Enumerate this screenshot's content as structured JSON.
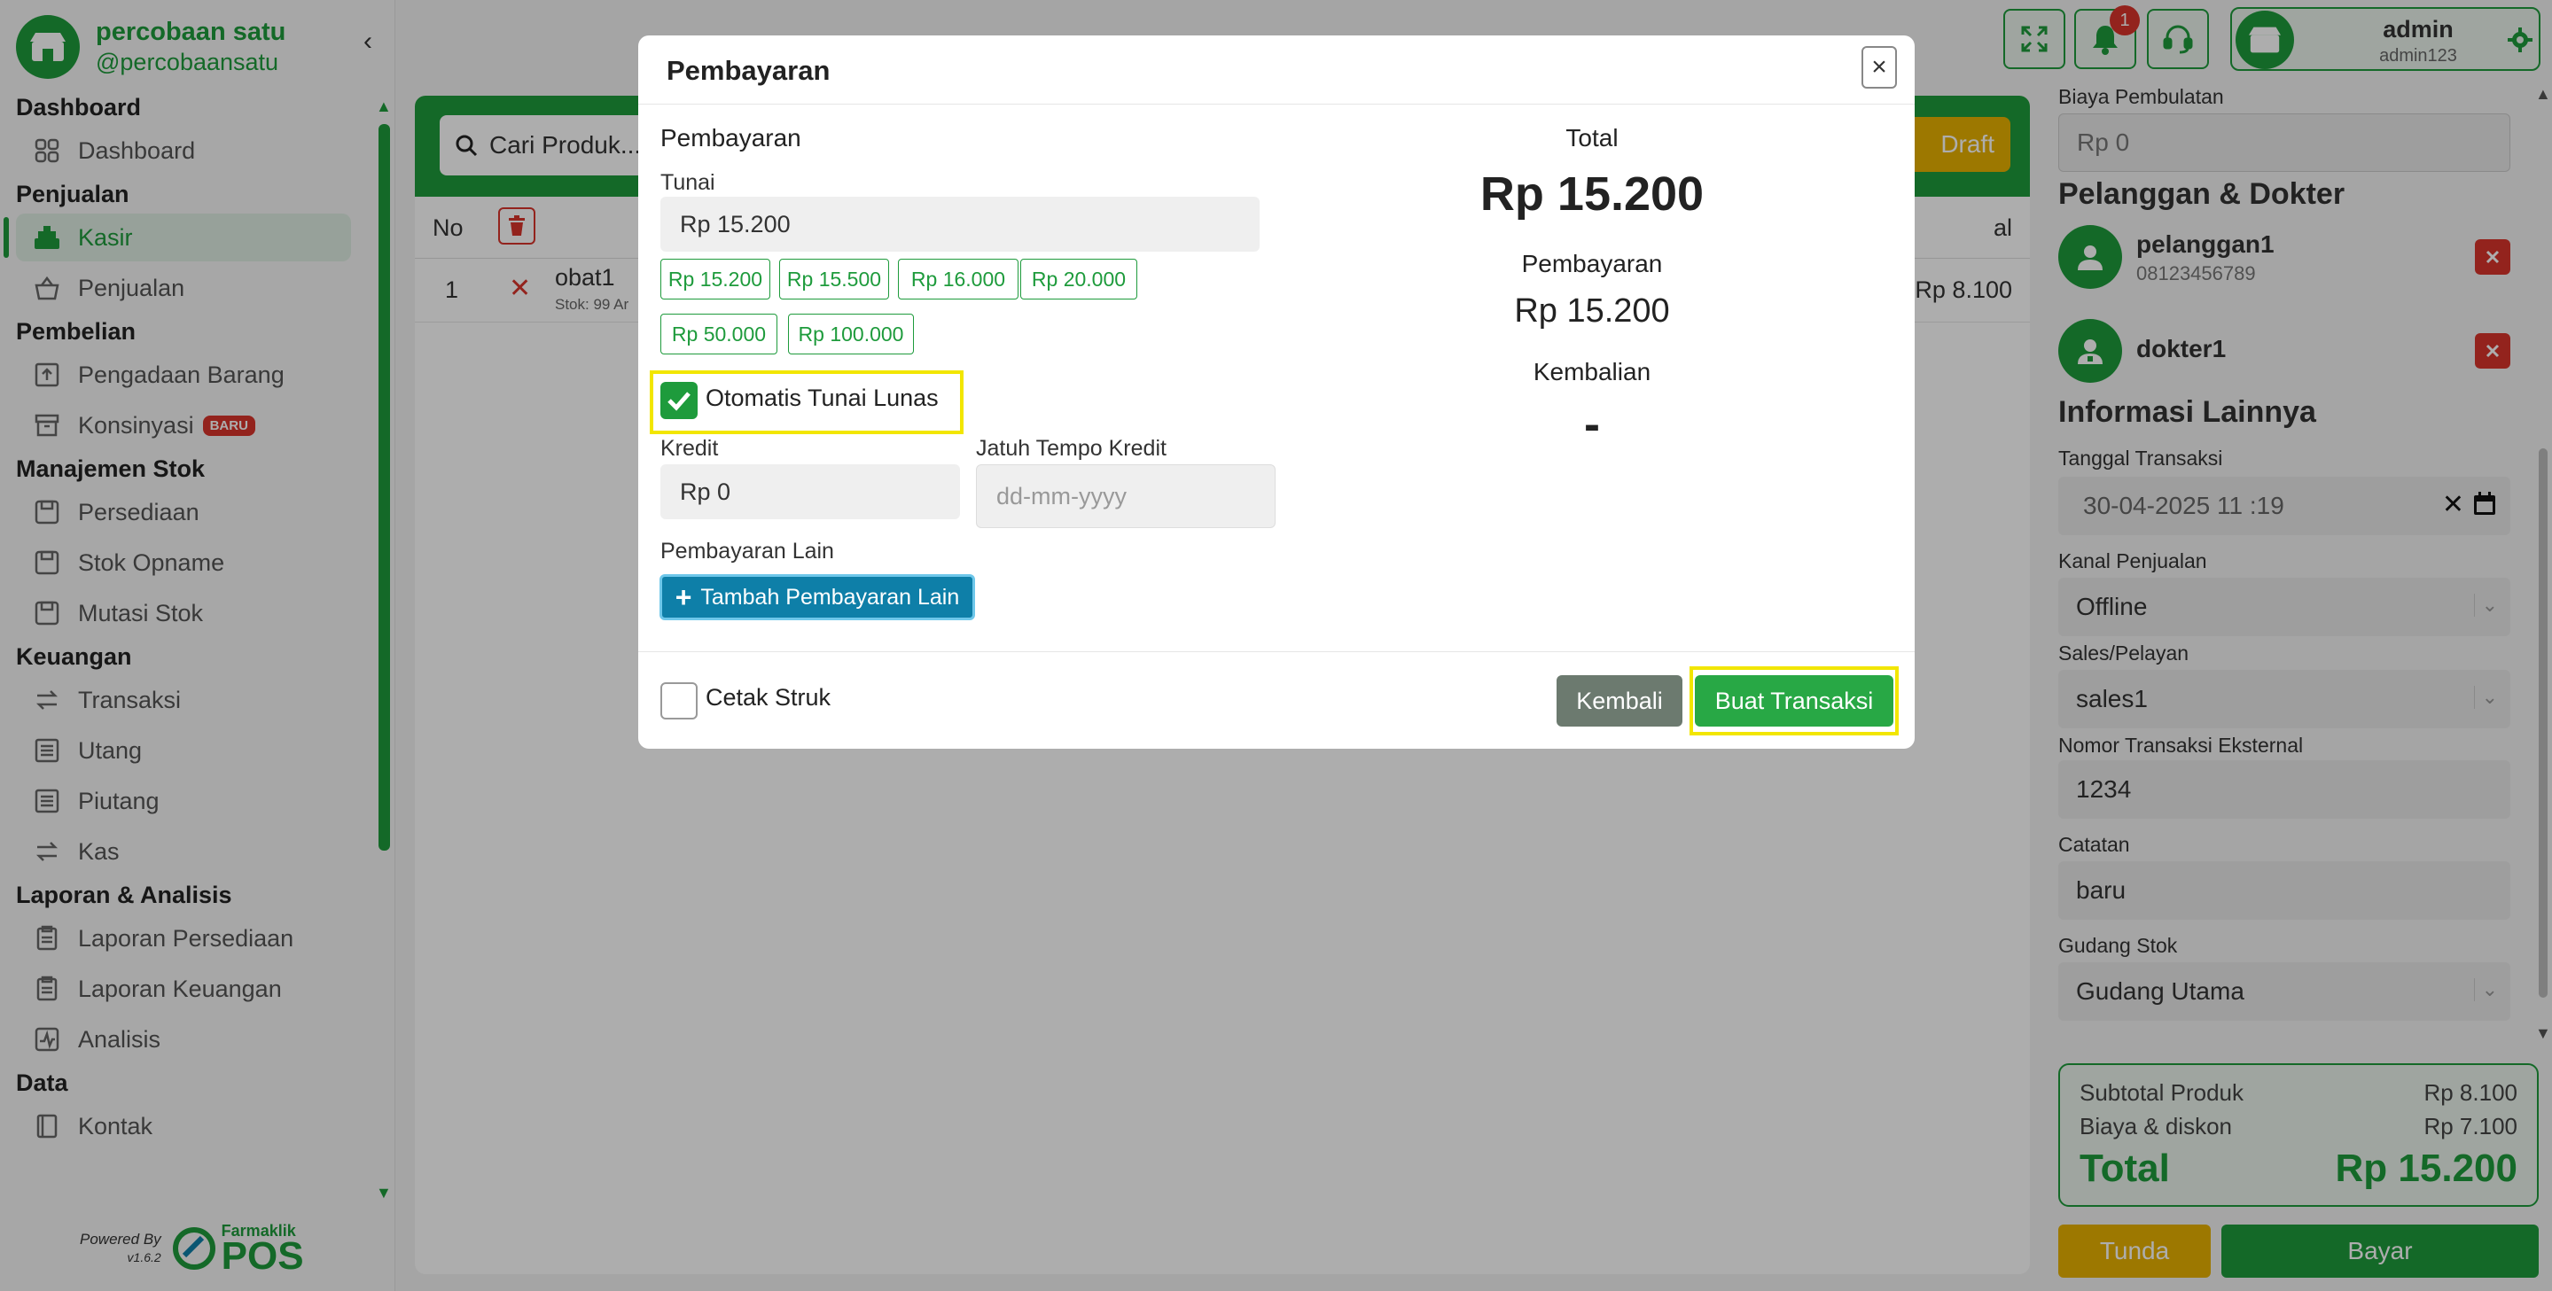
{
  "brand": {
    "name": "percobaan satu",
    "handle": "@percobaansatu"
  },
  "sidebar": {
    "sections": [
      {
        "title": "Dashboard",
        "items": [
          {
            "label": "Dashboard",
            "icon": "grid-icon"
          }
        ]
      },
      {
        "title": "Penjualan",
        "items": [
          {
            "label": "Kasir",
            "icon": "cash-register-icon",
            "active": true
          },
          {
            "label": "Penjualan",
            "icon": "basket-icon"
          }
        ]
      },
      {
        "title": "Pembelian",
        "items": [
          {
            "label": "Pengadaan Barang",
            "icon": "box-upload-icon"
          },
          {
            "label": "Konsinyasi",
            "icon": "archive-icon",
            "badge": "BARU"
          }
        ]
      },
      {
        "title": "Manajemen Stok",
        "items": [
          {
            "label": "Persediaan",
            "icon": "floppy-icon"
          },
          {
            "label": "Stok Opname",
            "icon": "floppy-icon"
          },
          {
            "label": "Mutasi Stok",
            "icon": "floppy-icon"
          }
        ]
      },
      {
        "title": "Keuangan",
        "items": [
          {
            "label": "Transaksi",
            "icon": "exchange-icon"
          },
          {
            "label": "Utang",
            "icon": "list-icon"
          },
          {
            "label": "Piutang",
            "icon": "list-icon"
          },
          {
            "label": "Kas",
            "icon": "exchange-icon"
          }
        ]
      },
      {
        "title": "Laporan & Analisis",
        "items": [
          {
            "label": "Laporan Persediaan",
            "icon": "clipboard-icon"
          },
          {
            "label": "Laporan Keuangan",
            "icon": "clipboard-icon"
          },
          {
            "label": "Analisis",
            "icon": "chart-icon"
          }
        ]
      },
      {
        "title": "Data",
        "items": [
          {
            "label": "Kontak",
            "icon": "contact-book-icon"
          }
        ]
      }
    ],
    "powered_by": "Powered By",
    "version": "v1.6.2",
    "pos_brand": "Farmaklik",
    "pos_word": "POS"
  },
  "topbar": {
    "notif_count": "1",
    "user_name": "admin",
    "user_sub": "admin123"
  },
  "main": {
    "search_placeholder": "Cari Produk...",
    "draft_label": "Draft",
    "col_no": "No",
    "col_right": "al",
    "rows": [
      {
        "no": "1",
        "name": "obat1",
        "stock": "Stok: 99 Ar",
        "price": "Rp 8.100"
      }
    ]
  },
  "right": {
    "biaya_label": "Biaya Pembulatan",
    "biaya_value": "Rp 0",
    "pelanggan_heading": "Pelanggan & Dokter",
    "pelanggan_name": "pelanggan1",
    "pelanggan_phone": "08123456789",
    "dokter_name": "dokter1",
    "info_heading": "Informasi Lainnya",
    "tanggal_label": "Tanggal Transaksi",
    "tanggal_value": "30-04-2025 11 :19",
    "kanal_label": "Kanal Penjualan",
    "kanal_value": "Offline",
    "sales_label": "Sales/Pelayan",
    "sales_value": "sales1",
    "nomor_label": "Nomor Transaksi Eksternal",
    "nomor_value": "1234",
    "catatan_label": "Catatan",
    "catatan_value": "baru",
    "gudang_label": "Gudang Stok",
    "gudang_value": "Gudang Utama",
    "subtotal_label": "Subtotal Produk",
    "subtotal_value": "Rp 8.100",
    "biaya_diskon_label": "Biaya & diskon",
    "biaya_diskon_value": "Rp 7.100",
    "total_label": "Total",
    "total_value": "Rp 15.200",
    "tunda_label": "Tunda",
    "bayar_label": "Bayar"
  },
  "modal": {
    "title": "Pembayaran",
    "section_title": "Pembayaran",
    "tunai_label": "Tunai",
    "tunai_value": "Rp 15.200",
    "chips": [
      "Rp 15.200",
      "Rp 15.500",
      "Rp 16.000",
      "Rp 20.000",
      "Rp 50.000",
      "Rp 100.000"
    ],
    "auto_label": "Otomatis Tunai Lunas",
    "auto_checked": true,
    "kredit_label": "Kredit",
    "kredit_value": "Rp 0",
    "jatuh_tempo_label": "Jatuh Tempo Kredit",
    "jatuh_tempo_placeholder": "dd-mm-yyyy",
    "lain_label": "Pembayaran Lain",
    "tambah_label": "Tambah Pembayaran Lain",
    "cetak_label": "Cetak Struk",
    "cetak_checked": false,
    "kembali_label": "Kembali",
    "buat_label": "Buat Transaksi",
    "summary_total_label": "Total",
    "summary_total_value": "Rp 15.200",
    "summary_bayar_label": "Pembayaran",
    "summary_bayar_value": "Rp 15.200",
    "summary_kembalian_label": "Kembalian",
    "summary_kembalian_value": "-"
  },
  "colors": {
    "primary": "#1e9b3c",
    "danger": "#d9342b",
    "warning": "#e8b100",
    "info": "#0e7fa8",
    "highlight": "#f2e600"
  }
}
